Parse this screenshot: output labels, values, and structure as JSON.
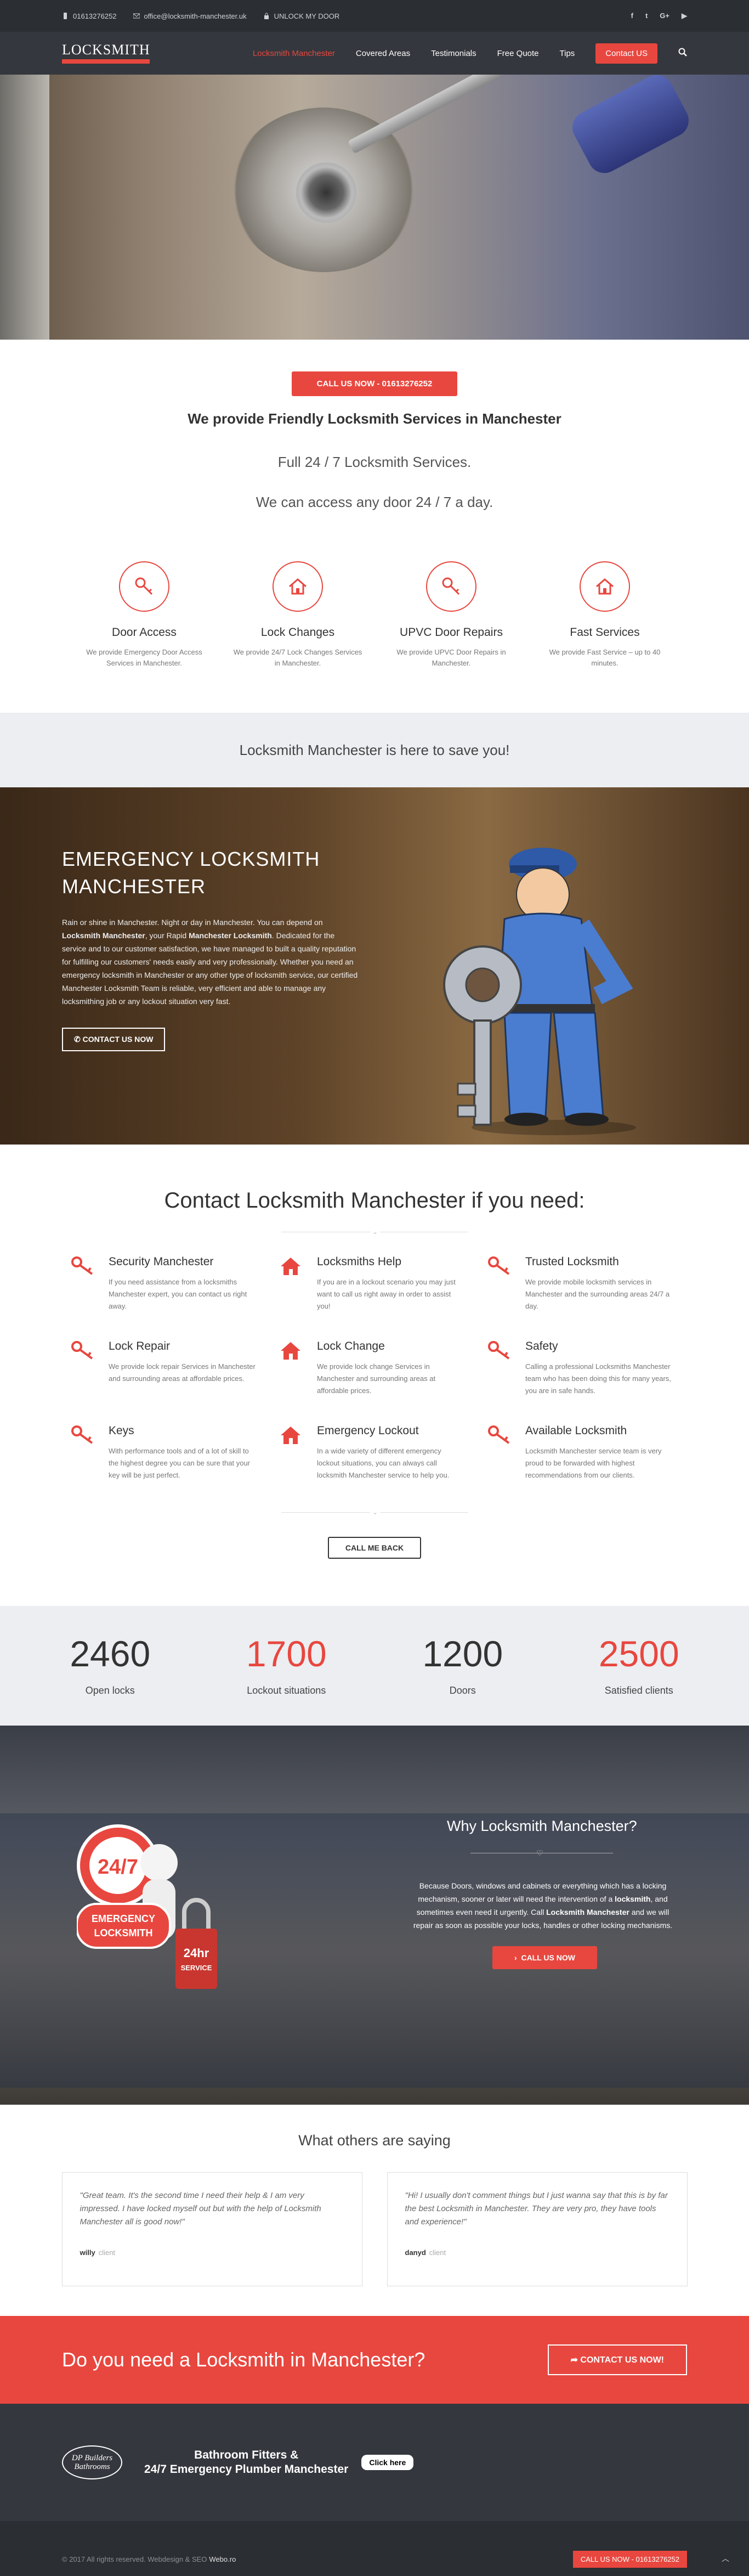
{
  "topbar": {
    "phone": "01613276252",
    "email": "office@locksmith-manchester.uk",
    "unlock": "UNLOCK MY DOOR",
    "social": [
      "f",
      "t",
      "G+",
      "▶"
    ]
  },
  "nav": {
    "logo_text": "LOCKSMITH",
    "items": [
      "Locksmith Manchester",
      "Covered Areas",
      "Testimonials",
      "Free Quote",
      "Tips"
    ],
    "contact_button": "Contact US"
  },
  "intro": {
    "call_button": "CALL US NOW - 01613276252",
    "heading": "We provide Friendly Locksmith Services in Manchester",
    "line1": "Full 24 / 7 Locksmith Services.",
    "line2": "We can access any door 24 / 7 a day."
  },
  "services": [
    {
      "icon": "key-icon",
      "title": "Door Access",
      "text": "We provide Emergency Door Access Services in Manchester."
    },
    {
      "icon": "home-icon",
      "title": "Lock Changes",
      "text": "We provide 24/7 Lock Changes Services in Manchester."
    },
    {
      "icon": "key-icon",
      "title": "UPVC Door Repairs",
      "text": "We provide UPVC Door Repairs in Manchester."
    },
    {
      "icon": "home-icon",
      "title": "Fast Services",
      "text": "We provide Fast Service – up to 40 minutes."
    }
  ],
  "banner": {
    "text": "Locksmith Manchester is here to save you!"
  },
  "emergency": {
    "title": "EMERGENCY LOCKSMITH MANCHESTER",
    "p1": "Rain or shine in Manchester. Night or day in Manchester. You can depend on ",
    "p1b": "Locksmith Manchester",
    "p2": ", your Rapid ",
    "p2b": "Manchester Locksmith",
    "p3": ". Dedicated for the service and to our customer satisfaction, we have managed to built a quality reputation for fulfilling our customers' needs easily and  very professionally. Whether you need an emergency locksmith in Manchester or any other type of locksmith service, our certified Manchester Locksmith Team is reliable, very efficient and able to manage any locksmithing job or  any lockout situation very fast.",
    "button": "CONTACT US NOW"
  },
  "contact": {
    "heading": "Contact Locksmith Manchester if you need:",
    "items": [
      {
        "icon": "key-icon",
        "title": "Security Manchester",
        "text": "If you need assistance from a locksmiths Manchester expert, you can contact us right away."
      },
      {
        "icon": "home-icon",
        "title": "Locksmiths Help",
        "text": "If you are in a lockout scenario you may just want to call us right away in order to assist you!"
      },
      {
        "icon": "key-icon",
        "title": "Trusted Locksmith",
        "text": "We provide mobile locksmith services in Manchester and the surrounding areas 24/7 a day."
      },
      {
        "icon": "key-icon",
        "title": "Lock Repair",
        "text": "We provide lock repair Services in Manchester and surrounding areas at affordable prices."
      },
      {
        "icon": "home-icon",
        "title": "Lock Change",
        "text": "We provide lock change Services in Manchester and surrounding areas at affordable prices."
      },
      {
        "icon": "key-icon",
        "title": "Safety",
        "text": "Calling a professional Locksmiths Manchester team who has been doing this for many years, you are in safe hands."
      },
      {
        "icon": "key-icon",
        "title": "Keys",
        "text": "With performance tools and of a lot of skill to the highest degree you can be sure that your key will be just perfect."
      },
      {
        "icon": "home-icon",
        "title": "Emergency Lockout",
        "text": "In a wide variety of different emergency lockout situations, you can always call locksmith Manchester service to help you."
      },
      {
        "icon": "key-icon",
        "title": "Available Locksmith",
        "text": "Locksmith Manchester service team is very proud to be forwarded with highest recommendations from our clients."
      }
    ],
    "button": "CALL ME BACK"
  },
  "stats": [
    {
      "number": "2460",
      "label": "Open locks"
    },
    {
      "number": "1700",
      "label": "Lockout situations"
    },
    {
      "number": "1200",
      "label": "Doors"
    },
    {
      "number": "2500",
      "label": "Satisfied clients"
    }
  ],
  "why": {
    "heading": "Why Locksmith Manchester?",
    "text_a": "Because Doors, windows and cabinets or everything which has a locking mechanism, sooner or later will need the intervention of a ",
    "text_b": "locksmith",
    "text_c": ", and sometimes even need it urgently. Call ",
    "text_d": "Locksmith Manchester",
    "text_e": " and we will repair as soon as possible your locks, handles or other locking mechanisms.",
    "button": "CALL US NOW",
    "badge_247": "24/7",
    "badge_emergency": "EMERGENCY LOCKSMITH",
    "badge_24hr": "24hr SERVICE"
  },
  "testimonials": {
    "heading": "What others are saying",
    "items": [
      {
        "quote": "\"Great team. It's the second time I need their help & I am very impressed. I have locked myself out but with the help of Locksmith Manchester all is good now!\"",
        "name": "willy",
        "role": "client"
      },
      {
        "quote": "\"Hi! I usually don't comment things but I just wanna say that this is by far the best Locksmith in Manchester. They are very pro, they have tools and experience!\"",
        "name": "danyd",
        "role": "client"
      }
    ]
  },
  "cta": {
    "text": "Do you need a Locksmith in Manchester?",
    "button": "CONTACT US NOW!"
  },
  "footer": {
    "ad_logo": "DP Builders Bathrooms",
    "ad_line1": "Bathroom Fitters &",
    "ad_line2": "24/7 Emergency Plumber Manchester",
    "ad_button": "Click here",
    "copyright": "© 2017 All rights reserved. Webdesign & SEO",
    "credit": "Webo.ro",
    "call_now": "CALL US NOW - 01613276252"
  },
  "colors": {
    "accent": "#e8473f",
    "dark": "#34373d",
    "topbar": "#2b2e33",
    "light": "#eceef1"
  }
}
